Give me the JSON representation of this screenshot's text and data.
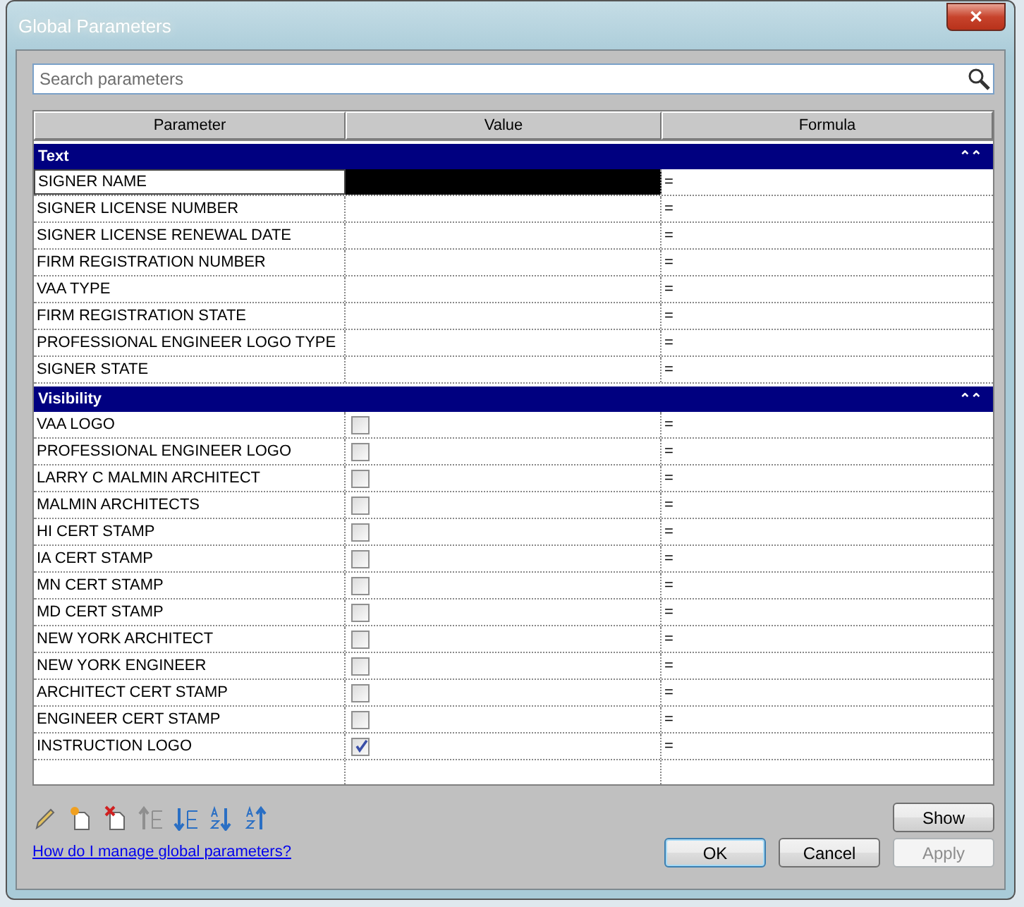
{
  "window": {
    "title": "Global Parameters",
    "close": "✕"
  },
  "search": {
    "placeholder": "Search parameters"
  },
  "table": {
    "columns": [
      "Parameter",
      "Value",
      "Formula"
    ],
    "groups": [
      {
        "name": "Text",
        "expanded": true,
        "toggle": "⌃",
        "rows": [
          {
            "name": "SIGNER NAME",
            "kind": "text",
            "selected": true,
            "formula": "="
          },
          {
            "name": "SIGNER LICENSE NUMBER",
            "kind": "text",
            "selected": false,
            "formula": "="
          },
          {
            "name": "SIGNER LICENSE RENEWAL DATE",
            "kind": "text",
            "selected": false,
            "formula": "="
          },
          {
            "name": "FIRM REGISTRATION NUMBER",
            "kind": "text",
            "selected": false,
            "formula": "="
          },
          {
            "name": "VAA TYPE",
            "kind": "text",
            "selected": false,
            "formula": "="
          },
          {
            "name": "FIRM REGISTRATION STATE",
            "kind": "text",
            "selected": false,
            "formula": "="
          },
          {
            "name": "PROFESSIONAL ENGINEER LOGO TYPE",
            "kind": "text",
            "selected": false,
            "formula": "="
          },
          {
            "name": "SIGNER STATE",
            "kind": "text",
            "selected": false,
            "formula": "="
          }
        ]
      },
      {
        "name": "Visibility",
        "expanded": true,
        "toggle": "⌃",
        "rows": [
          {
            "name": "VAA LOGO",
            "kind": "checkbox",
            "checked": false,
            "selected": false,
            "formula": "="
          },
          {
            "name": "PROFESSIONAL ENGINEER LOGO",
            "kind": "checkbox",
            "checked": false,
            "selected": false,
            "formula": "="
          },
          {
            "name": "LARRY C MALMIN ARCHITECT",
            "kind": "checkbox",
            "checked": false,
            "selected": false,
            "formula": "="
          },
          {
            "name": "MALMIN ARCHITECTS",
            "kind": "checkbox",
            "checked": false,
            "selected": false,
            "formula": "="
          },
          {
            "name": "HI CERT STAMP",
            "kind": "checkbox",
            "checked": false,
            "selected": false,
            "formula": "="
          },
          {
            "name": "IA CERT STAMP",
            "kind": "checkbox",
            "checked": false,
            "selected": false,
            "formula": "="
          },
          {
            "name": "MN CERT STAMP",
            "kind": "checkbox",
            "checked": false,
            "selected": false,
            "formula": "="
          },
          {
            "name": "MD CERT STAMP",
            "kind": "checkbox",
            "checked": false,
            "selected": false,
            "formula": "="
          },
          {
            "name": "NEW YORK ARCHITECT",
            "kind": "checkbox",
            "checked": false,
            "selected": false,
            "formula": "="
          },
          {
            "name": "NEW YORK ENGINEER",
            "kind": "checkbox",
            "checked": false,
            "selected": false,
            "formula": "="
          },
          {
            "name": "ARCHITECT CERT STAMP",
            "kind": "checkbox",
            "checked": false,
            "selected": false,
            "formula": "="
          },
          {
            "name": "ENGINEER CERT STAMP",
            "kind": "checkbox",
            "checked": false,
            "selected": false,
            "formula": "="
          },
          {
            "name": "INSTRUCTION LOGO",
            "kind": "checkbox",
            "checked": true,
            "selected": false,
            "formula": "="
          }
        ]
      }
    ]
  },
  "toolbar": [
    {
      "kind": "edit",
      "disabled": false
    },
    {
      "kind": "new",
      "disabled": false
    },
    {
      "kind": "delete",
      "disabled": false
    },
    {
      "kind": "move-up",
      "disabled": true
    },
    {
      "kind": "move-down",
      "disabled": false
    },
    {
      "kind": "sort-ascending",
      "disabled": false
    },
    {
      "kind": "sort-descending",
      "disabled": false
    }
  ],
  "show_button": "Show",
  "help_link": "How do I manage global parameters?",
  "buttons": [
    {
      "label": "OK",
      "default": true,
      "disabled": false
    },
    {
      "label": "Cancel",
      "default": false,
      "disabled": false
    },
    {
      "label": "Apply",
      "default": false,
      "disabled": true
    }
  ]
}
